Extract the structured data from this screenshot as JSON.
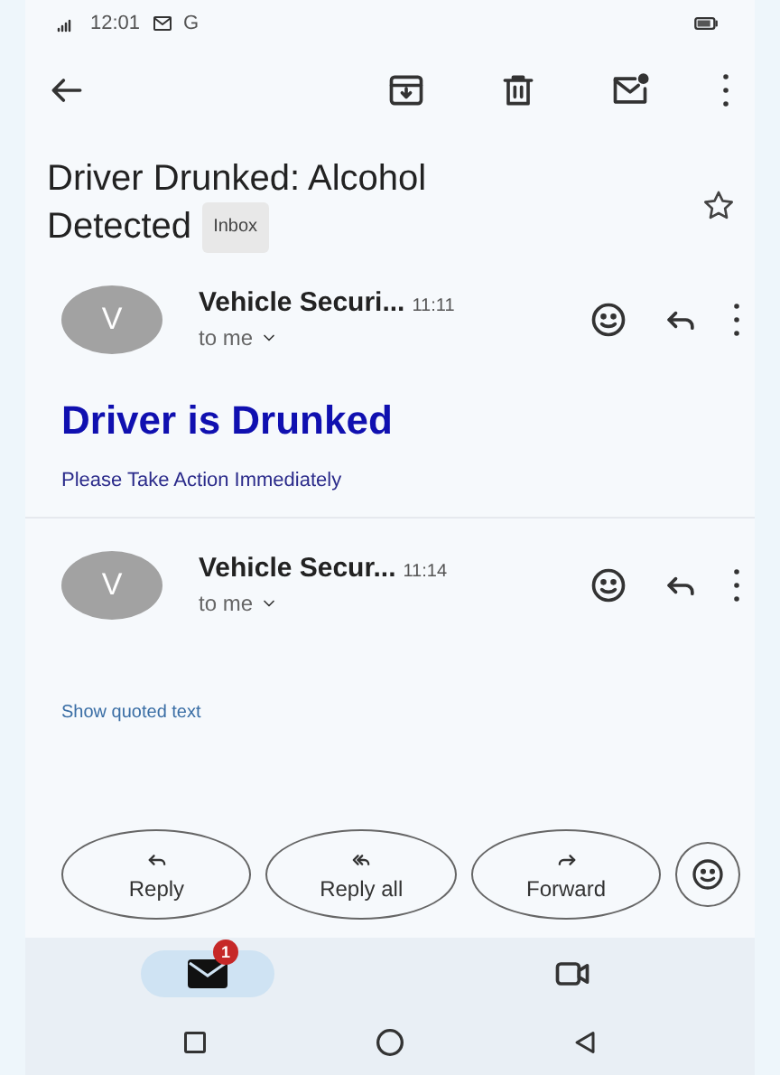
{
  "status_bar": {
    "time": "12:01",
    "carrier": "G"
  },
  "subject": {
    "title_lines": [
      "Driver Drunked: Alcohol",
      "Detected"
    ],
    "label": "Inbox",
    "starred": false
  },
  "messages": [
    {
      "avatar": "V",
      "sender": "Vehicle Securi...",
      "time": "11:11",
      "recipient": "to me",
      "body_heading": "Driver is Drunked",
      "body_text": "Please Take Action Immediately"
    },
    {
      "avatar": "V",
      "sender": "Vehicle Secur...",
      "time": "11:14",
      "recipient": "to me",
      "quoted_link": "Show quoted text"
    }
  ],
  "actions": [
    "Reply",
    "Reply all",
    "Forward"
  ],
  "bottom_nav": [
    {
      "kind": "mail",
      "selected": true,
      "badge": "1"
    },
    {
      "kind": "video",
      "selected": false
    }
  ]
}
